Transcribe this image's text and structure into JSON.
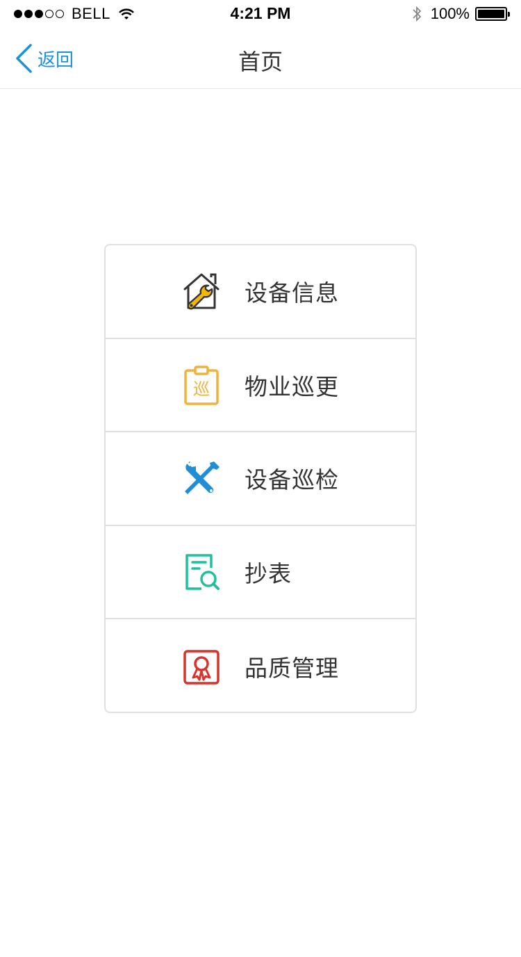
{
  "status_bar": {
    "carrier": "BELL",
    "time": "4:21 PM",
    "battery": "100%",
    "signal_strength": 3,
    "signal_total": 5
  },
  "nav": {
    "back_label": "返回",
    "title": "首页",
    "accent_color": "#1e90d8"
  },
  "menu": {
    "items": [
      {
        "label": "设备信息",
        "icon": "house-wrench-icon",
        "color": "#f0b400"
      },
      {
        "label": "物业巡更",
        "icon": "patrol-clipboard-icon",
        "color": "#f0b43c"
      },
      {
        "label": "设备巡检",
        "icon": "tools-icon",
        "color": "#1e8fd6"
      },
      {
        "label": "抄表",
        "icon": "document-search-icon",
        "color": "#1fbf9f"
      },
      {
        "label": "品质管理",
        "icon": "quality-certificate-icon",
        "color": "#d9342b"
      }
    ]
  }
}
